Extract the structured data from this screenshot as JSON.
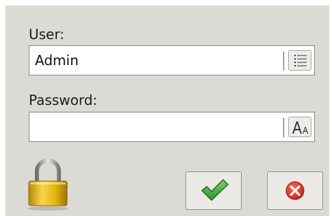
{
  "login": {
    "user_label": "User:",
    "user_value": "Admin",
    "password_label": "Password:",
    "password_value": ""
  },
  "icons": {
    "user_field_icon": "list-icon",
    "password_field_icon": "font-size-icon",
    "status_icon": "padlock-icon",
    "ok_icon": "checkmark-icon",
    "cancel_icon": "cancel-icon"
  },
  "colors": {
    "dialog_bg": "#dcdad5",
    "ok_green": "#3fa83a",
    "cancel_red": "#d9291c",
    "lock_gold": "#e5b30f"
  }
}
